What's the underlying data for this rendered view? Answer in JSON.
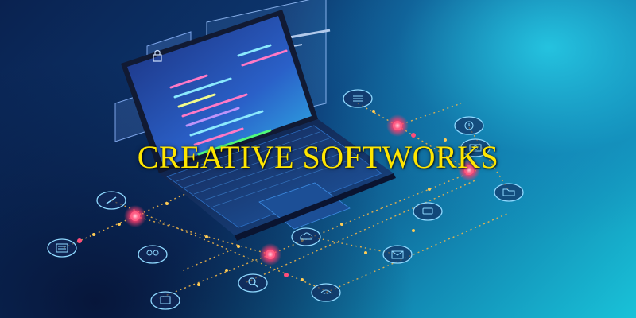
{
  "headline": "CREATIVE SOFTWORKS",
  "colors": {
    "headline": "#ffe600",
    "node_active": "#ff3d6e",
    "node_line": "#f0b54a",
    "icon_stroke": "#8fd9ff",
    "background_dark": "#0a2250",
    "background_light": "#19c2d8"
  },
  "icons": [
    "document-icon",
    "pen-icon",
    "user-group-icon",
    "building-icon",
    "cloud-icon",
    "search-icon",
    "wifi-icon",
    "mail-icon",
    "chat-icon",
    "folder-icon",
    "camera-icon",
    "clock-icon",
    "list-icon",
    "lock-icon"
  ]
}
